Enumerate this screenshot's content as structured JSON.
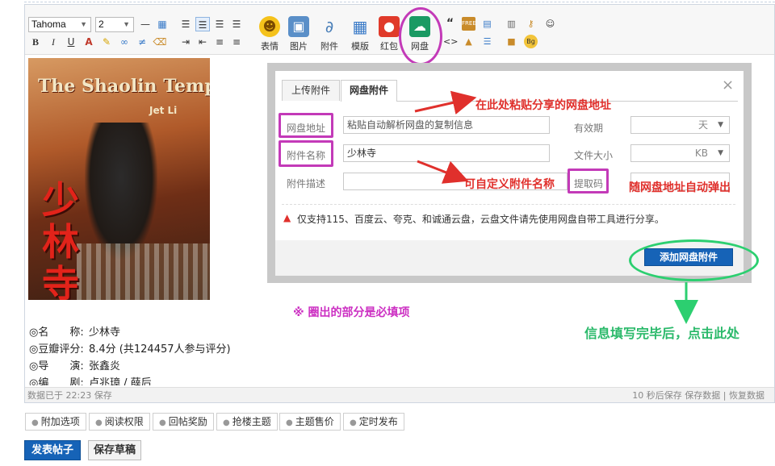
{
  "toolbar": {
    "font_family": "Tahoma",
    "font_size": "2",
    "buttons": {
      "emoji": "表情",
      "image": "图片",
      "attachment": "附件",
      "template": "模版",
      "red_packet": "红包",
      "netdisk": "网盘"
    },
    "mini_labels": {
      "free": "FREE",
      "bg": "Bg"
    }
  },
  "poster": {
    "title_en": "The Shaolin Temple",
    "actor": "Jet Li",
    "title_cn": "少林寺"
  },
  "movie_info": [
    {
      "key": "◎名　　称:",
      "value": "少林寺"
    },
    {
      "key": "◎豆瓣评分:",
      "value": "8.4分 (共124457人参与评分)"
    },
    {
      "key": "◎导　　演:",
      "value": "张鑫炎"
    },
    {
      "key": "◎编　　剧:",
      "value": "卢兆璋 / 薛后"
    }
  ],
  "dialog": {
    "tabs": [
      "上传附件",
      "网盘附件"
    ],
    "close": "×",
    "fields": {
      "url_label": "网盘地址",
      "url_placeholder": "粘贴自动解析网盘的复制信息",
      "name_label": "附件名称",
      "name_value": "少林寺",
      "desc_label": "附件描述",
      "code_label": "提取码",
      "validity_label": "有效期",
      "validity_unit": "天",
      "size_label": "文件大小",
      "size_unit": "KB"
    },
    "notice": "仅支持115、百度云、夸克、和诚通云盘，云盘文件请先使用网盘自带工具进行分享。",
    "submit": "添加网盘附件"
  },
  "annotations": {
    "paste_here": "在此处粘贴分享的网盘地址",
    "custom_name": "可自定义附件名称",
    "auto_popup": "随网盘地址自动弹出",
    "required": "※ 圈出的部分是必填项",
    "click_here": "信息填写完毕后，点击此处"
  },
  "statusbar": {
    "left": "数据已于 22:23 保存",
    "right": "10 秒后保存 保存数据 | 恢复数据"
  },
  "options": [
    "附加选项",
    "阅读权限",
    "回帖奖励",
    "抢楼主题",
    "主题售价",
    "定时发布"
  ],
  "actions": {
    "post": "发表帖子",
    "draft": "保存草稿"
  }
}
